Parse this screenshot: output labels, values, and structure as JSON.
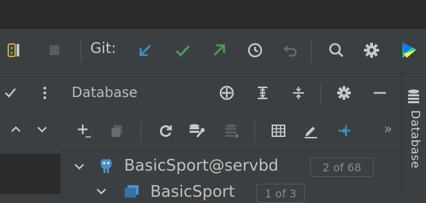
{
  "toolbar": {
    "git_label": "Git:",
    "colors": {
      "update": "#3592c4",
      "commit": "#499c54",
      "push": "#499c54",
      "stop_disabled": "#6e6e6e"
    }
  },
  "left_panel": {
    "row2_icons": [
      "chevron-up-icon",
      "chevron-down-icon"
    ]
  },
  "database_panel": {
    "title": "Database",
    "header_icons": [
      "crosshair-icon",
      "expand-all-icon",
      "collapse-all-icon",
      "gear-icon",
      "minimize-icon"
    ],
    "toolbar_icons": [
      "add-icon",
      "copy-icon",
      "refresh-icon",
      "properties-icon",
      "database-disabled-icon",
      "table-icon",
      "edit-icon",
      "jump-icon",
      "more-icon"
    ],
    "more_label": "»",
    "tree": [
      {
        "label": "BasicSport@servbd",
        "badge": "2 of 68",
        "icon": "postgresql-icon"
      },
      {
        "label": "BasicSport",
        "badge": "1 of 3",
        "icon": "schema-icon"
      }
    ]
  },
  "right_strip": {
    "label": "Database",
    "icon": "database-stack-icon"
  }
}
